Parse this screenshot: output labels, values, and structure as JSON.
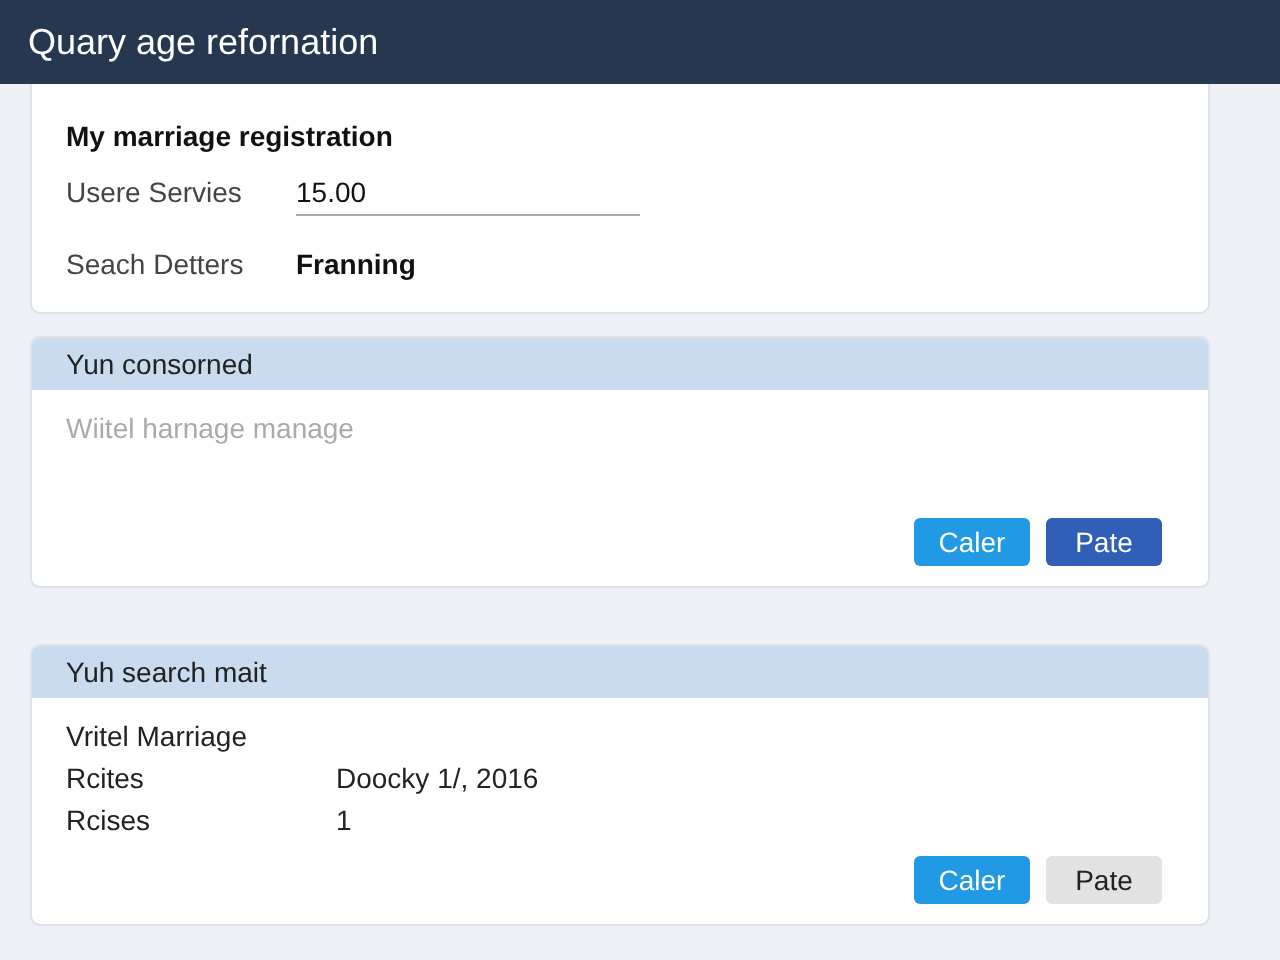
{
  "window": {
    "title": "Quary age refornation"
  },
  "registration": {
    "heading": "My marriage registration",
    "fields": [
      {
        "kind": "input",
        "label": "Usere Servies",
        "value": "15.00"
      },
      {
        "kind": "text",
        "label": "Seach Detters",
        "value": "Franning"
      }
    ]
  },
  "panels": [
    {
      "title": "Yun consorned",
      "lines": [
        {
          "label": "Wiitel harnage manage",
          "muted": true
        }
      ],
      "buttons": [
        {
          "label": "Caler",
          "kind": "primary"
        },
        {
          "label": "Pate",
          "kind": "dark"
        }
      ]
    },
    {
      "title": "Yuh search mait",
      "lines": [
        {
          "label": "Vritel Marriage",
          "muted": false
        },
        {
          "label": "Rcites",
          "value": "Doocky 1/, 2016",
          "muted": false
        },
        {
          "label": "Rcises",
          "value": "1",
          "muted": false
        }
      ],
      "buttons": [
        {
          "label": "Caler",
          "kind": "primary"
        },
        {
          "label": "Pate",
          "kind": "secondary"
        }
      ]
    }
  ]
}
